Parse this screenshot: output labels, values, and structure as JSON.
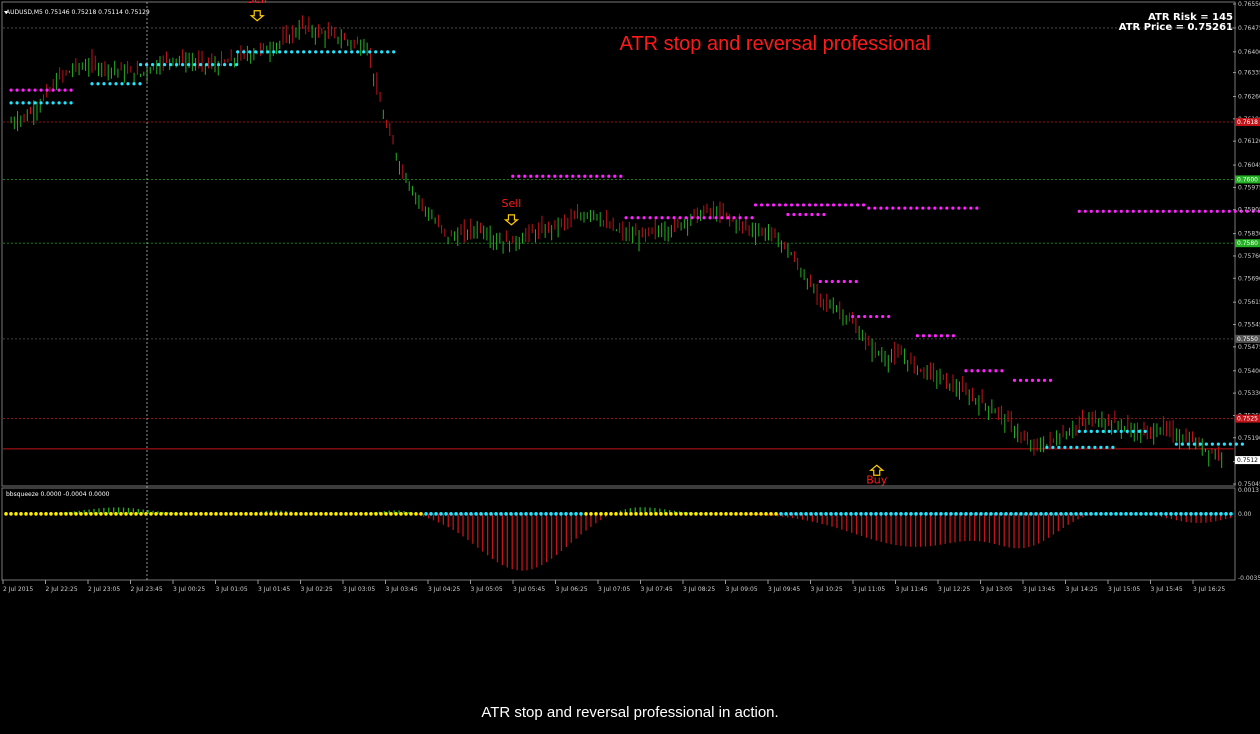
{
  "symbol_header": "AUDUSD,M5  0.75146 0.75218 0.75114 0.75129",
  "chart_title": "ATR stop and reversal professional",
  "atr_risk": "ATR Risk = 145",
  "atr_price": "ATR Price = 0.75261",
  "indicator_header": "bbsqueeze 0.0000 -0.0004 0.0000",
  "caption": "ATR stop and reversal professional in action.",
  "signals": [
    {
      "label": "Sell",
      "type": "sell",
      "x_time_index": 11.9,
      "price": 0.7651
    },
    {
      "label": "Sell",
      "type": "sell",
      "x_time_index": 23.8,
      "price": 0.7587
    },
    {
      "label": "Buy",
      "type": "buy",
      "x_time_index": 40.9,
      "price": 0.7511
    }
  ],
  "colors": {
    "background": "#000000",
    "bull": "#22b022",
    "bear": "#c0141a",
    "stop_short": "#ff22ff",
    "stop_long": "#22e6ff",
    "title": "#ff1a1a",
    "grid": "#3a3a3a",
    "signal_arrow": "#ffcc00",
    "squeeze_dot_on": "#ffee00",
    "squeeze_dot_off": "#22e6ff"
  },
  "chart_data": [
    {
      "type": "line",
      "panel": "price",
      "ylim": [
        0.75045,
        0.7655
      ],
      "y_ticks": [
        "0.76550",
        "0.76475",
        "0.76400",
        "0.76335",
        "0.76260",
        "0.76190",
        "0.76120",
        "0.76045",
        "0.75975",
        "0.75905",
        "0.75830",
        "0.75760",
        "0.75690",
        "0.75615",
        "0.75545",
        "0.75475",
        "0.75400",
        "0.75330",
        "0.75260",
        "0.75190",
        "0.75115",
        "0.75045"
      ],
      "price_labels": [
        {
          "value": "0.7618",
          "color": "#c0141a"
        },
        {
          "value": "0.7600",
          "color": "#22b022"
        },
        {
          "value": "0.7580",
          "color": "#22b022"
        },
        {
          "value": "0.7550",
          "color": "#555555"
        },
        {
          "value": "0.7525",
          "color": "#c0141a"
        },
        {
          "value": "0.7512",
          "color": "#ffffff"
        }
      ],
      "x_ticks": [
        "2 Jul 2015",
        "2 Jul 22:25",
        "2 Jul 23:05",
        "2 Jul 23:45",
        "3 Jul 00:25",
        "3 Jul 01:05",
        "3 Jul 01:45",
        "3 Jul 02:25",
        "3 Jul 03:05",
        "3 Jul 03:45",
        "3 Jul 04:25",
        "3 Jul 05:05",
        "3 Jul 05:45",
        "3 Jul 06:25",
        "3 Jul 07:05",
        "3 Jul 07:45",
        "3 Jul 08:25",
        "3 Jul 09:05",
        "3 Jul 09:45",
        "3 Jul 10:25",
        "3 Jul 11:05",
        "3 Jul 11:45",
        "3 Jul 12:25",
        "3 Jul 13:05",
        "3 Jul 13:45",
        "3 Jul 14:25",
        "3 Jul 15:05",
        "3 Jul 15:45",
        "3 Jul 16:25"
      ],
      "close_path": [
        0.7618,
        0.762,
        0.7625,
        0.7632,
        0.7635,
        0.7636,
        0.7635,
        0.7634,
        0.7633,
        0.7636,
        0.7638,
        0.7637,
        0.7636,
        0.7636,
        0.7638,
        0.764,
        0.7641,
        0.7644,
        0.7648,
        0.7646,
        0.7645,
        0.7643,
        0.7642,
        0.762,
        0.7605,
        0.7595,
        0.7588,
        0.7582,
        0.7583,
        0.7585,
        0.7581,
        0.758,
        0.7583,
        0.7584,
        0.7586,
        0.7588,
        0.759,
        0.7585,
        0.7583,
        0.7582,
        0.7584,
        0.7585,
        0.7588,
        0.759,
        0.7589,
        0.7586,
        0.7584,
        0.7583,
        0.7578,
        0.757,
        0.7562,
        0.756,
        0.7555,
        0.7548,
        0.7544,
        0.7545,
        0.7541,
        0.7539,
        0.7536,
        0.7533,
        0.753,
        0.7527,
        0.7522,
        0.7516,
        0.7517,
        0.752,
        0.7523,
        0.7525,
        0.7524,
        0.7522,
        0.752,
        0.7522,
        0.752,
        0.7518,
        0.7515,
        0.7513
      ],
      "stop_series": [
        {
          "name": "short_stop",
          "segments": [
            [
              0,
              4,
              0.7628
            ],
            [
              31,
              38,
              0.7601
            ],
            [
              38,
              46,
              0.7588
            ],
            [
              46,
              53,
              0.7592
            ],
            [
              53,
              60,
              0.7591
            ],
            [
              66,
              80,
              0.759
            ]
          ]
        },
        {
          "name": "long_stop",
          "segments": [
            [
              0,
              4,
              0.7624
            ],
            [
              5,
              8,
              0.763
            ],
            [
              8,
              14,
              0.7636
            ],
            [
              14,
              24,
              0.764
            ]
          ]
        }
      ]
    },
    {
      "type": "bar",
      "panel": "bbsqueeze",
      "ylim": [
        -0.0035,
        0.0013
      ],
      "y_ticks": [
        "0.0013",
        "0.00",
        "-0.0035"
      ],
      "zero_line": 0
    }
  ]
}
